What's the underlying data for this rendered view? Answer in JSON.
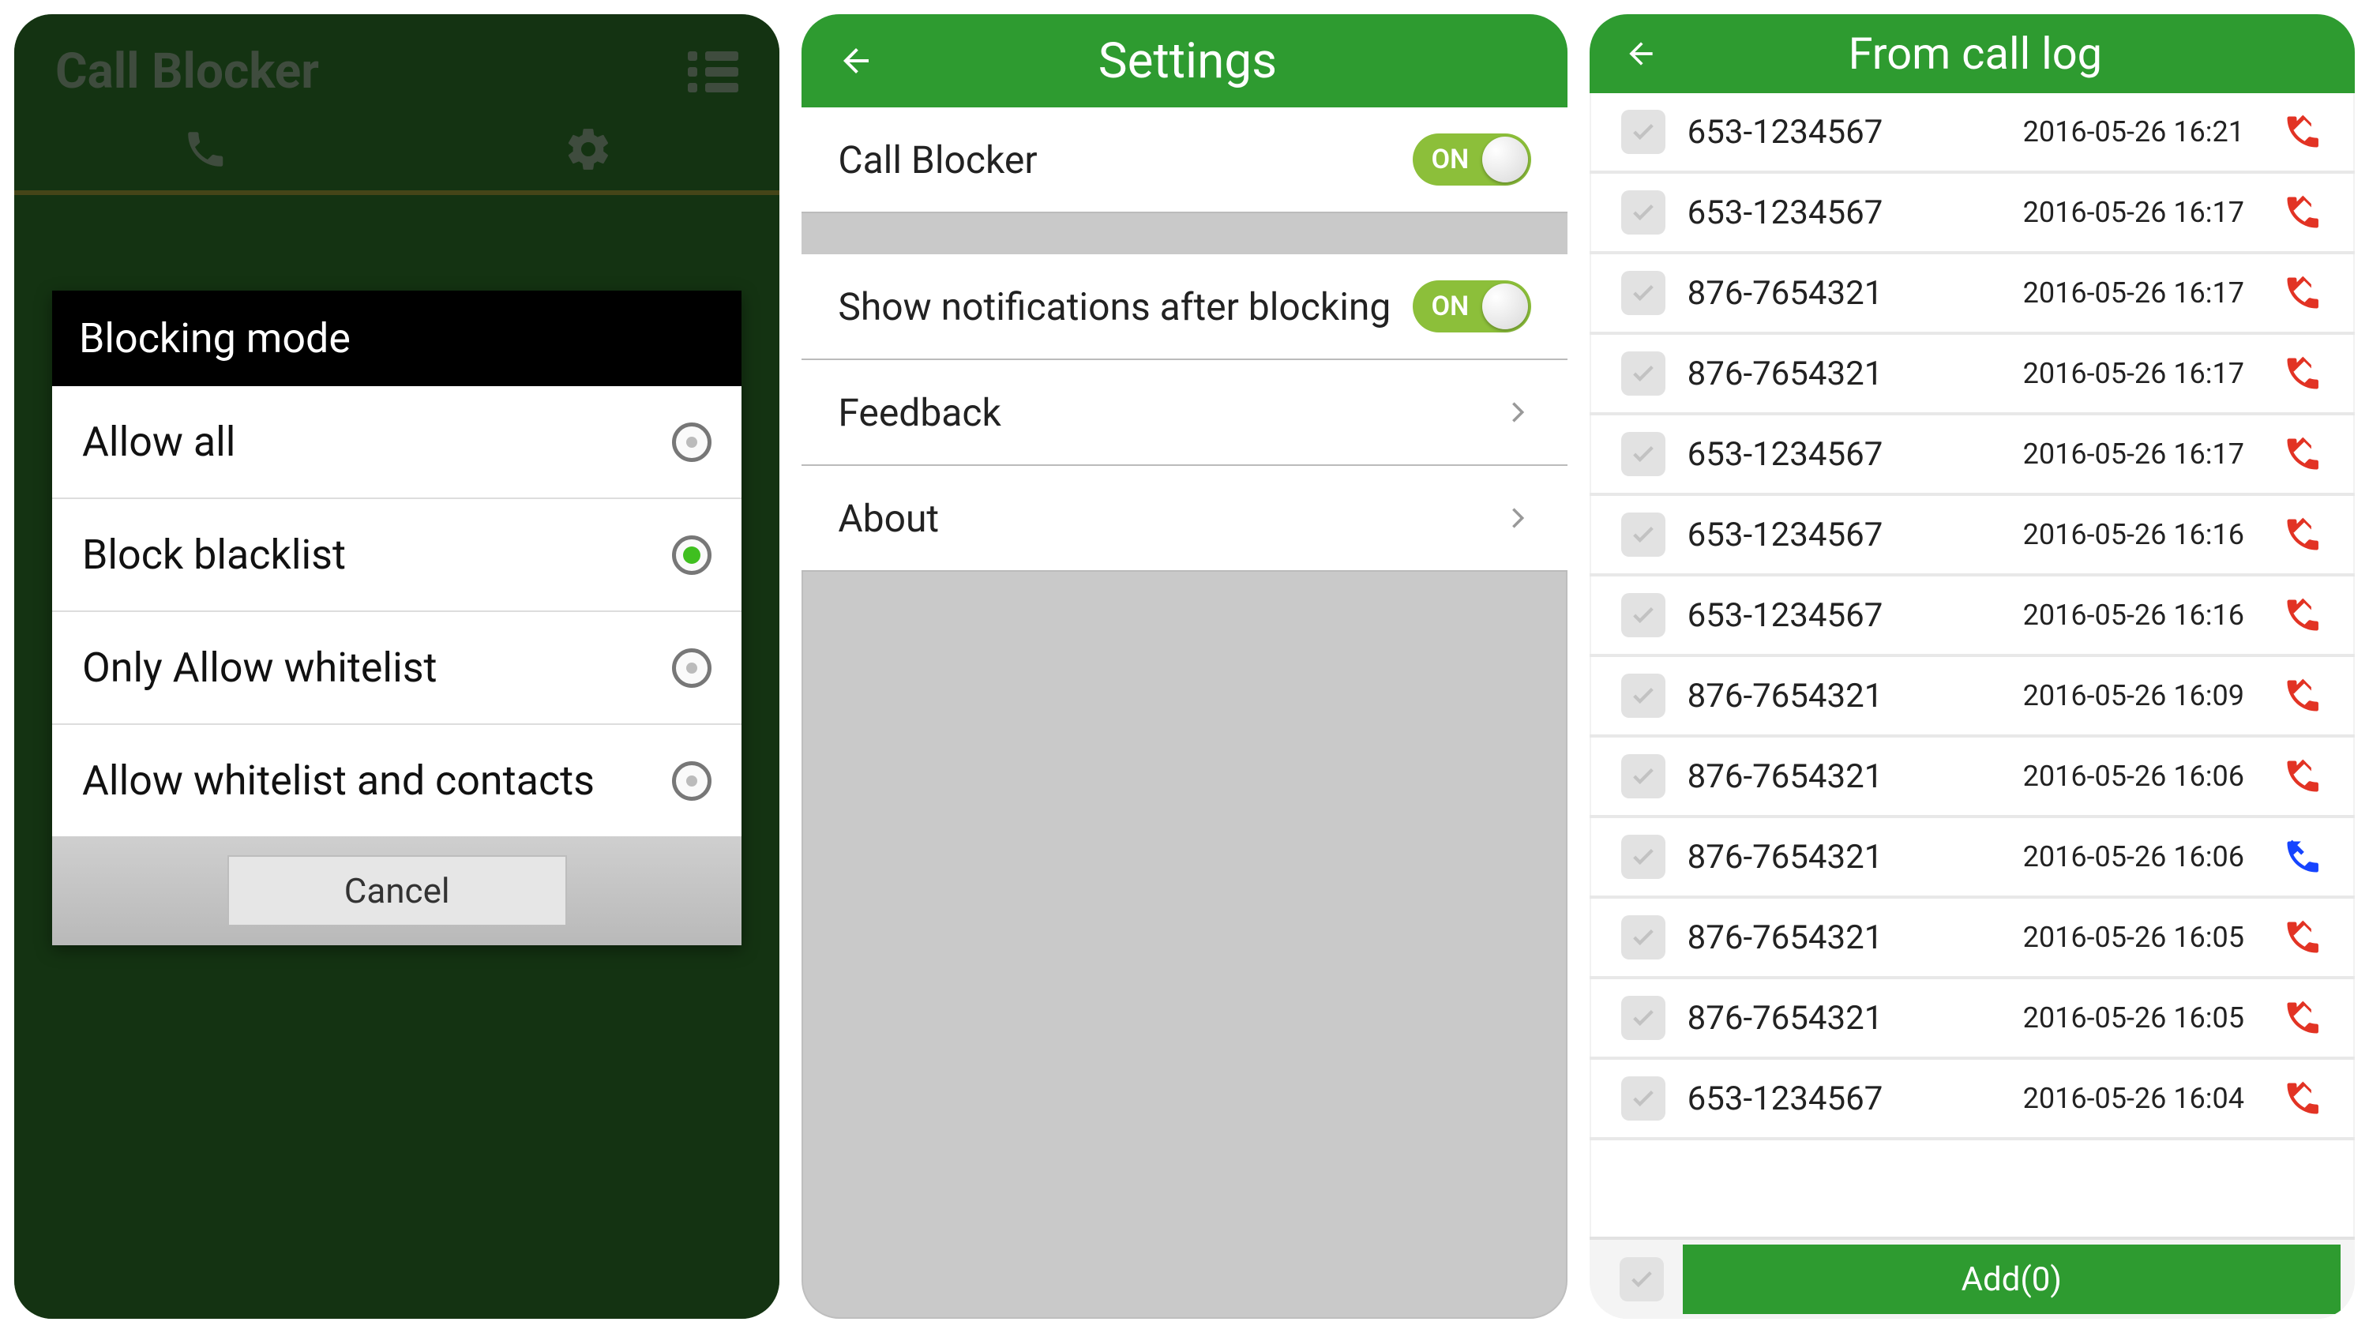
{
  "colors": {
    "brand": "#2e9b30",
    "accent": "#8cbf3a",
    "danger": "#e23324",
    "incoming": "#1644ff"
  },
  "screen1": {
    "title": "Call Blocker",
    "dialog": {
      "title": "Blocking mode",
      "options": [
        {
          "label": "Allow all",
          "selected": false
        },
        {
          "label": "Block blacklist",
          "selected": true
        },
        {
          "label": "Only Allow whitelist",
          "selected": false
        },
        {
          "label": "Allow whitelist and contacts",
          "selected": false
        }
      ],
      "cancel": "Cancel"
    }
  },
  "screen2": {
    "title": "Settings",
    "rows": {
      "call_blocker": {
        "label": "Call Blocker",
        "toggle": "ON"
      },
      "notifications": {
        "label": "Show notifications after blocking",
        "toggle": "ON"
      },
      "feedback": {
        "label": "Feedback"
      },
      "about": {
        "label": "About"
      }
    }
  },
  "screen3": {
    "title": "From call log",
    "items": [
      {
        "number": "653-1234567",
        "time": "2016-05-26 16:21",
        "type": "missed"
      },
      {
        "number": "653-1234567",
        "time": "2016-05-26 16:17",
        "type": "missed"
      },
      {
        "number": "876-7654321",
        "time": "2016-05-26 16:17",
        "type": "missed"
      },
      {
        "number": "876-7654321",
        "time": "2016-05-26 16:17",
        "type": "missed"
      },
      {
        "number": "653-1234567",
        "time": "2016-05-26 16:17",
        "type": "missed"
      },
      {
        "number": "653-1234567",
        "time": "2016-05-26 16:16",
        "type": "missed"
      },
      {
        "number": "653-1234567",
        "time": "2016-05-26 16:16",
        "type": "missed"
      },
      {
        "number": "876-7654321",
        "time": "2016-05-26 16:09",
        "type": "missed"
      },
      {
        "number": "876-7654321",
        "time": "2016-05-26 16:06",
        "type": "missed"
      },
      {
        "number": "876-7654321",
        "time": "2016-05-26 16:06",
        "type": "incoming"
      },
      {
        "number": "876-7654321",
        "time": "2016-05-26 16:05",
        "type": "missed"
      },
      {
        "number": "876-7654321",
        "time": "2016-05-26 16:05",
        "type": "missed"
      },
      {
        "number": "653-1234567",
        "time": "2016-05-26 16:04",
        "type": "missed"
      }
    ],
    "add_label": "Add(0)"
  }
}
